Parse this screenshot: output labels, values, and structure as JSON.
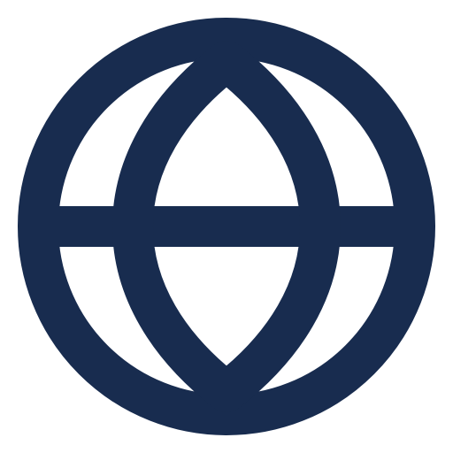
{
  "icon": {
    "name": "globe-icon",
    "color": "#182c4f"
  }
}
